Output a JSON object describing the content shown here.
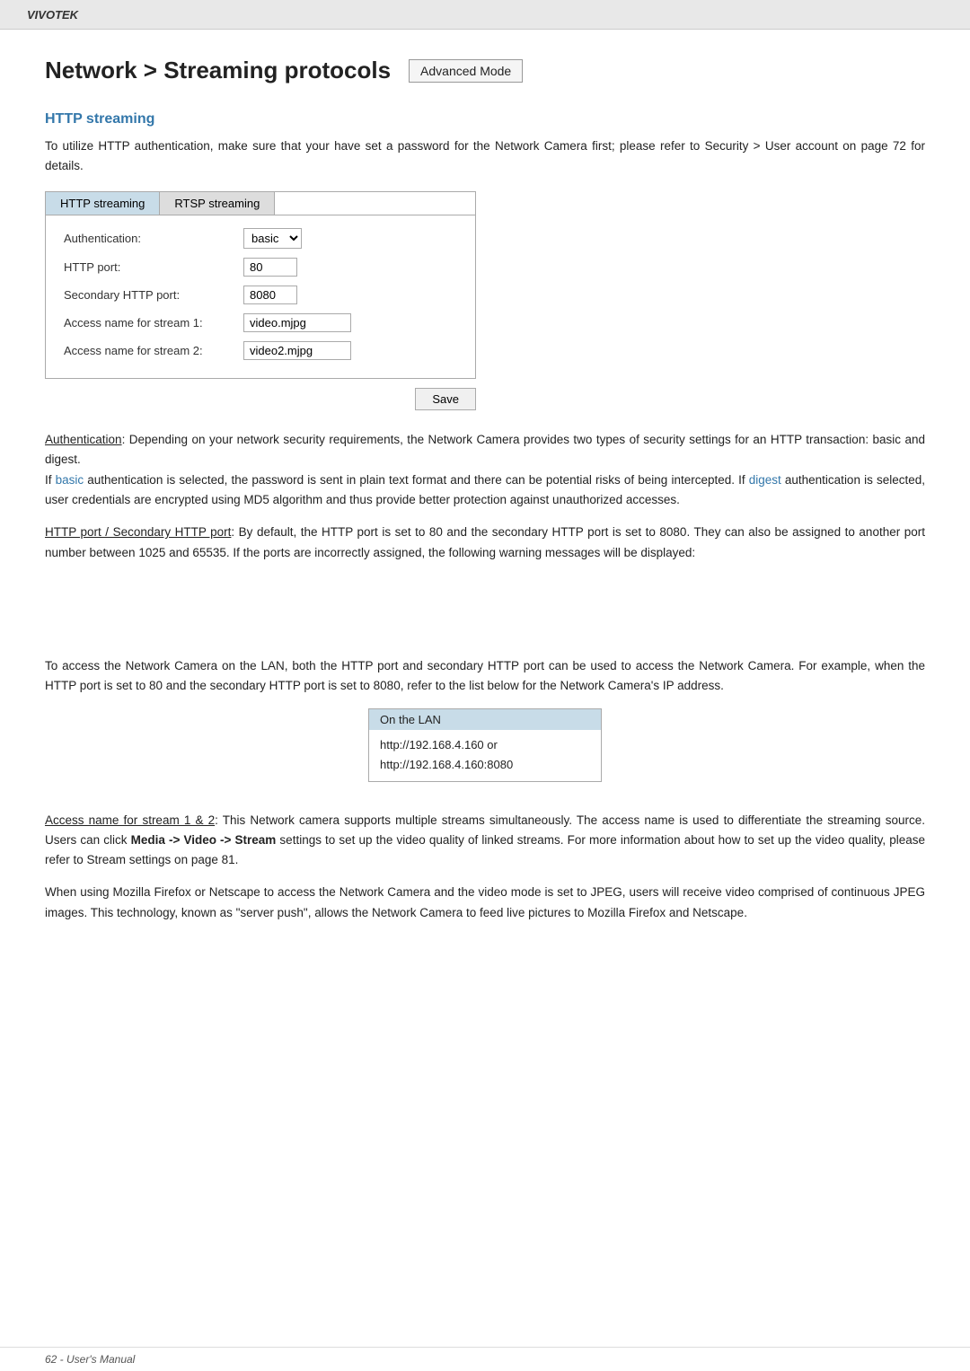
{
  "header": {
    "brand": "VIVOTEK"
  },
  "page": {
    "title": "Network > Streaming protocols",
    "advanced_mode_label": "Advanced Mode"
  },
  "http_streaming": {
    "section_title": "HTTP streaming",
    "intro": "To utilize HTTP authentication, make sure that your have set a password for the Network Camera first; please refer to Security > User account on page 72 for details.",
    "tab1_label": "HTTP streaming",
    "tab2_label": "RTSP streaming",
    "form": {
      "auth_label": "Authentication:",
      "auth_value": "basic",
      "http_port_label": "HTTP port:",
      "http_port_value": "80",
      "sec_http_port_label": "Secondary HTTP port:",
      "sec_http_port_value": "8080",
      "stream1_label": "Access name for stream 1:",
      "stream1_value": "video.mjpg",
      "stream2_label": "Access name for stream 2:",
      "stream2_value": "video2.mjpg"
    },
    "save_label": "Save"
  },
  "auth_desc": {
    "term": "Authentication",
    "text1": ": Depending on your network security requirements, the Network Camera provides two types of security settings for an HTTP transaction: basic and digest.",
    "text2_pre": "If ",
    "basic_link": "basic",
    "text2_mid": " authentication is selected, the password is sent in plain text format and there can be potential risks of being intercepted. If ",
    "digest_link": "digest",
    "text2_post": " authentication is selected, user credentials are encrypted using MD5 algorithm and thus provide better protection against unauthorized accesses."
  },
  "port_desc": {
    "term": "HTTP port / Secondary HTTP port",
    "text": ": By default, the HTTP port is set to 80 and the secondary HTTP port is set to 8080. They can also be assigned to another port number between 1025 and 65535. If the ports are incorrectly assigned, the following warning messages will be displayed:"
  },
  "lan_desc": {
    "pre_text": "To access the Network Camera on the LAN, both the HTTP port and secondary HTTP port can be used to access the Network Camera. For example, when the HTTP port is set to 80 and the secondary HTTP port is set to 8080, refer to the list below for the Network Camera's IP address.",
    "table_header": "On the LAN",
    "table_row1": "http://192.168.4.160  or",
    "table_row2": "http://192.168.4.160:8080"
  },
  "stream_desc": {
    "term": "Access name for stream 1 & 2",
    "text": ": This Network camera supports multiple streams simultaneously. The access name is used to differentiate the streaming source. Users can click ",
    "bold_part": "Media -> Video -> Stream",
    "text2": " settings to set up the video quality of linked streams. For more information about how to set up the video quality, please refer to Stream settings on page 81."
  },
  "mozilla_desc": {
    "text": "When using Mozilla Firefox or  Netscape  to access the Network Camera and the video mode is set to JPEG, users will receive video comprised of continuous JPEG images. This technology, known as \"server push\", allows the Network Camera to feed live pictures to Mozilla Firefox and Netscape."
  },
  "footer": {
    "text": "62 - User's Manual"
  }
}
